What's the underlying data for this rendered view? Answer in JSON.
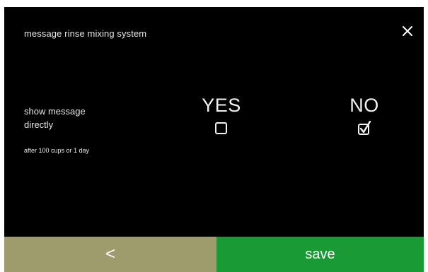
{
  "dialog": {
    "title": "message rinse mixing system"
  },
  "setting": {
    "label_line1": "show message",
    "label_line2": "directly",
    "sublabel": "after 100 cups or 1 day"
  },
  "options": {
    "yes": {
      "label": "YES",
      "checked": false
    },
    "no": {
      "label": "NO",
      "checked": true
    }
  },
  "footer": {
    "back_label": "<",
    "save_label": "save"
  },
  "colors": {
    "screen_bg": "#000000",
    "back_button_bg": "#9e9c6c",
    "save_button_bg": "#1a9a35",
    "text": "#e6e6e6"
  },
  "icons": {
    "close": "close-icon",
    "unchecked": "checkbox-empty-icon",
    "checked": "checkbox-checked-icon"
  }
}
